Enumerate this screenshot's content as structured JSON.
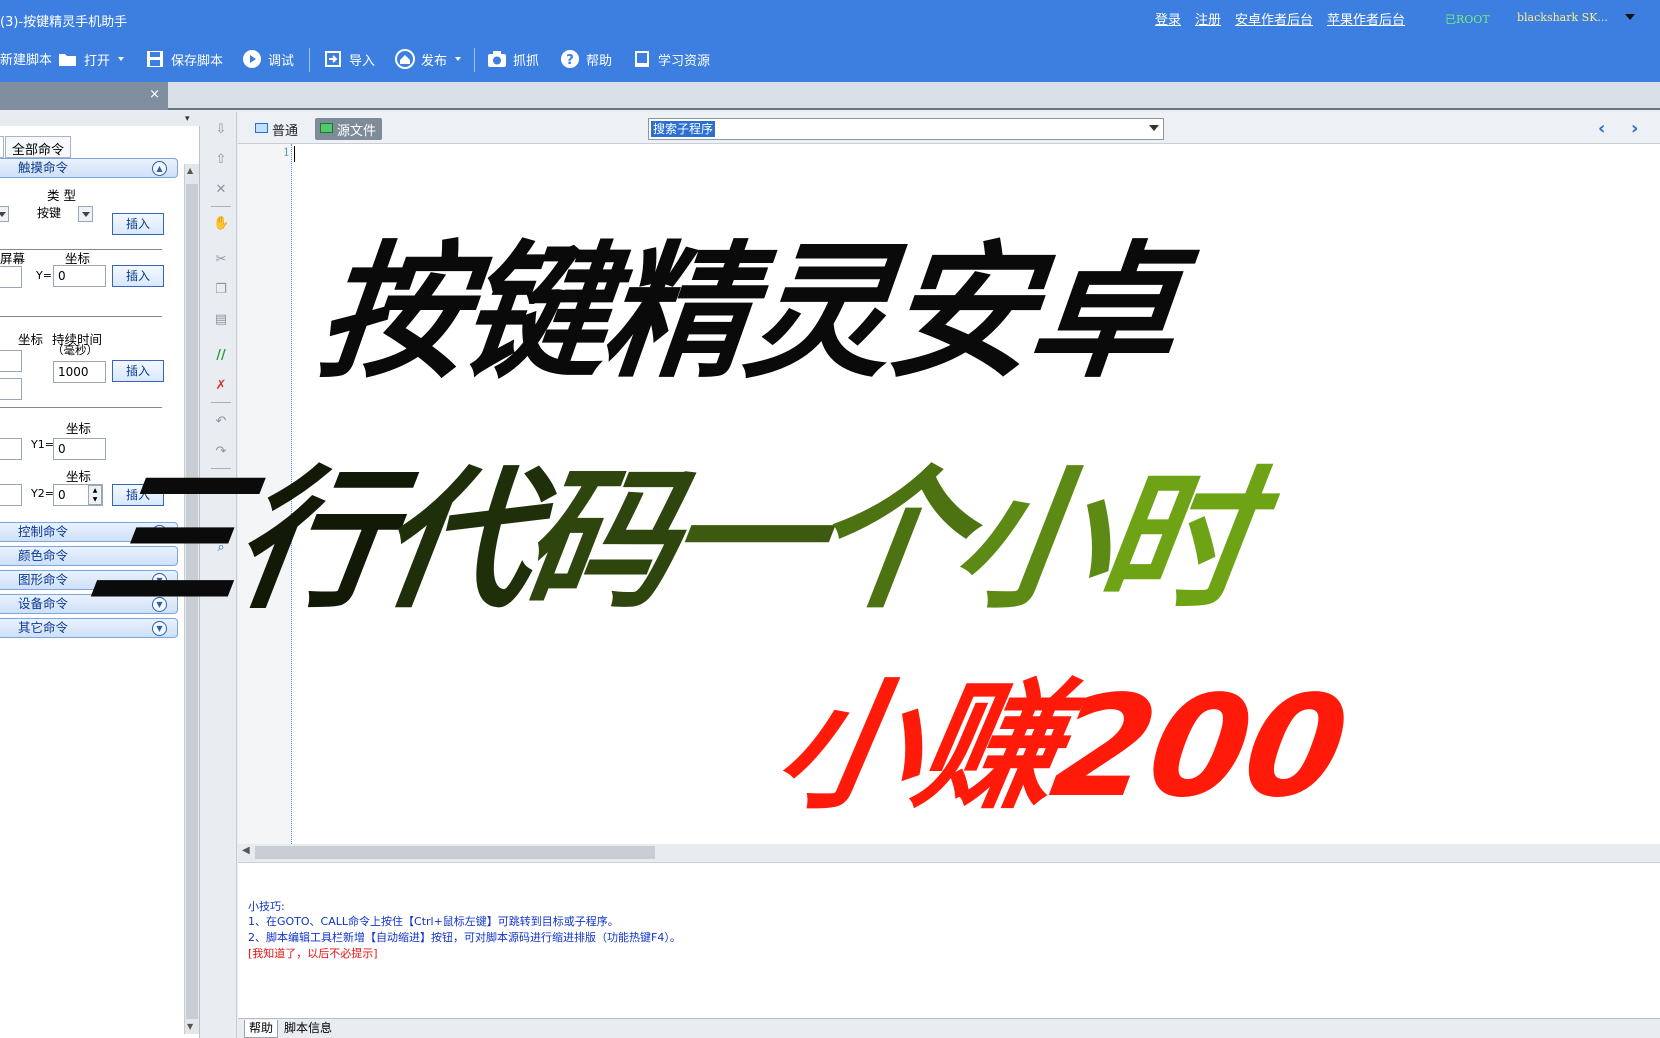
{
  "window": {
    "title": "(3)-按键精灵手机助手",
    "links": [
      "登录",
      "注册",
      "安卓作者后台",
      "苹果作者后台"
    ],
    "root_badge": "已ROOT",
    "device": "blackshark  SK..."
  },
  "toolbar": {
    "new_script": "新建脚本",
    "open": "打开",
    "save": "保存脚本",
    "debug": "调试",
    "import": "导入",
    "publish": "发布",
    "capture": "抓抓",
    "help": "帮助",
    "learn": "学习资源"
  },
  "left_panel": {
    "close": "×",
    "all_commands_tab": "全部命令",
    "groups": {
      "touch": "触摸命令",
      "control": "控制命令",
      "color": "颜色命令",
      "graphic": "图形命令",
      "device": "设备命令",
      "other": "其它命令"
    },
    "tap": {
      "type_label": "类 型",
      "type_value": "按键",
      "insert": "插入"
    },
    "touch_pos": {
      "screen_label": "屏幕",
      "coord_label": "坐标",
      "y_label": "Y=",
      "y_value": "0",
      "insert": "插入"
    },
    "hold": {
      "coord_label": "坐标",
      "duration_label": "持续时间",
      "duration_unit": "（毫秒）",
      "duration_value": "1000",
      "insert": "插入"
    },
    "swipe": {
      "coord1_label": "坐标",
      "y1_label": "Y1=",
      "y1_value": "0",
      "coord2_label": "坐标",
      "y2_label": "Y2=",
      "y2_value": "0",
      "insert": "插入"
    }
  },
  "editor": {
    "tab_normal": "普通",
    "tab_source": "源文件",
    "subroutine_search": "搜索子程序",
    "line_numbers": [
      "1"
    ]
  },
  "overlay": {
    "line1": "按键精灵安卓",
    "line2_chars": [
      "三",
      "行",
      "代",
      "码",
      "一",
      "个",
      "小",
      "时"
    ],
    "line2_colors": [
      "#0b0b0b",
      "#121a07",
      "#1f2f0a",
      "#2e450d",
      "#3d5a10",
      "#4c7212",
      "#5c8a14",
      "#6ea316"
    ],
    "line3": "小赚200"
  },
  "tips": {
    "title": "小技巧:",
    "line1": "1、在GOTO、CALL命令上按住【Ctrl+鼠标左键】可跳转到目标或子程序。",
    "line2": "2、脚本编辑工具栏新增【自动缩进】按钮，可对脚本源码进行缩进排版（功能热键F4）。",
    "dismiss": "[我知道了，以后不必提示]"
  },
  "bottom_tabs": [
    "帮助",
    "脚本信息"
  ]
}
